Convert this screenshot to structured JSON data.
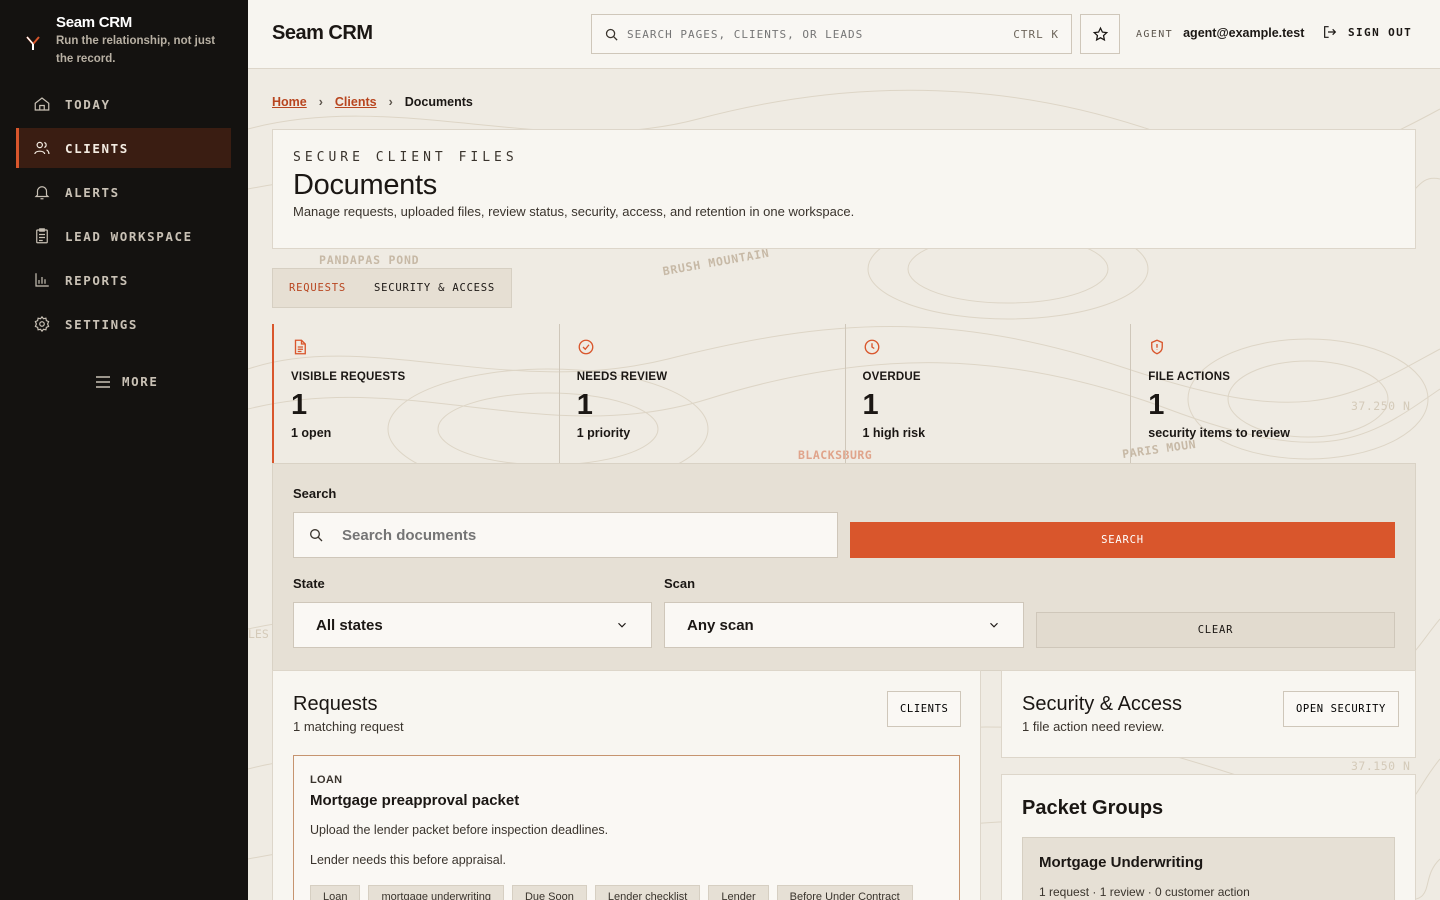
{
  "app": {
    "name": "Seam CRM",
    "tagline": "Run the relationship, not just the record."
  },
  "sidebar": {
    "items": [
      {
        "label": "TODAY",
        "icon": "home-icon"
      },
      {
        "label": "CLIENTS",
        "icon": "users-icon",
        "active": true
      },
      {
        "label": "ALERTS",
        "icon": "bell-icon"
      },
      {
        "label": "LEAD WORKSPACE",
        "icon": "clipboard-icon"
      },
      {
        "label": "REPORTS",
        "icon": "bar-chart-icon"
      },
      {
        "label": "SETTINGS",
        "icon": "gear-icon"
      }
    ],
    "more_label": "MORE"
  },
  "header": {
    "title": "Seam CRM",
    "search_placeholder": "SEARCH PAGES, CLIENTS, OR LEADS",
    "search_shortcut": "CTRL K",
    "agent_label": "AGENT",
    "agent_email": "agent@example.test",
    "signout_label": "SIGN OUT"
  },
  "breadcrumb": {
    "home": "Home",
    "clients": "Clients",
    "current": "Documents"
  },
  "hero": {
    "eyebrow": "SECURE CLIENT FILES",
    "title": "Documents",
    "description": "Manage requests, uploaded files, review status, security, access, and retention in one workspace."
  },
  "map_labels": {
    "pond": "PANDAPAS POND",
    "mountain": "BRUSH MOUNTAIN",
    "town": "BLACKSBURG",
    "paris": "PARIS MOUN",
    "coord1": "37.250 N",
    "coord2": "37.150 N",
    "les": "LES"
  },
  "tabs": [
    {
      "label": "REQUESTS",
      "active": true
    },
    {
      "label": "SECURITY & ACCESS",
      "active": false
    }
  ],
  "stats": [
    {
      "icon": "document-icon",
      "label": "VISIBLE REQUESTS",
      "value": "1",
      "sub": "1 open"
    },
    {
      "icon": "check-circle-icon",
      "label": "NEEDS REVIEW",
      "value": "1",
      "sub": "1 priority"
    },
    {
      "icon": "clock-icon",
      "label": "OVERDUE",
      "value": "1",
      "sub": "1 high risk"
    },
    {
      "icon": "shield-icon",
      "label": "FILE ACTIONS",
      "value": "1",
      "sub": "security items to review"
    }
  ],
  "filters": {
    "search_label": "Search",
    "search_placeholder": "Search documents",
    "search_button": "SEARCH",
    "state_label": "State",
    "state_value": "All states",
    "scan_label": "Scan",
    "scan_value": "Any scan",
    "clear_button": "CLEAR"
  },
  "requests": {
    "title": "Requests",
    "subtitle": "1 matching request",
    "clients_button": "CLIENTS",
    "card": {
      "type": "LOAN",
      "title": "Mortgage preapproval packet",
      "description": "Upload the lender packet before inspection deadlines.",
      "note": "Lender needs this before appraisal.",
      "chips": [
        "Loan",
        "mortgage underwriting",
        "Due Soon",
        "Lender checklist",
        "Lender",
        "Before Under Contract"
      ]
    }
  },
  "security": {
    "title": "Security & Access",
    "subtitle": "1 file action need review.",
    "button": "OPEN SECURITY"
  },
  "packet_groups": {
    "title": "Packet Groups",
    "group_name": "Mortgage Underwriting",
    "group_meta": "1 request · 1 review · 0 customer action"
  },
  "colors": {
    "accent": "#d9562c",
    "sidebar_bg": "#141210",
    "active_nav_bg": "#3a1d12"
  }
}
